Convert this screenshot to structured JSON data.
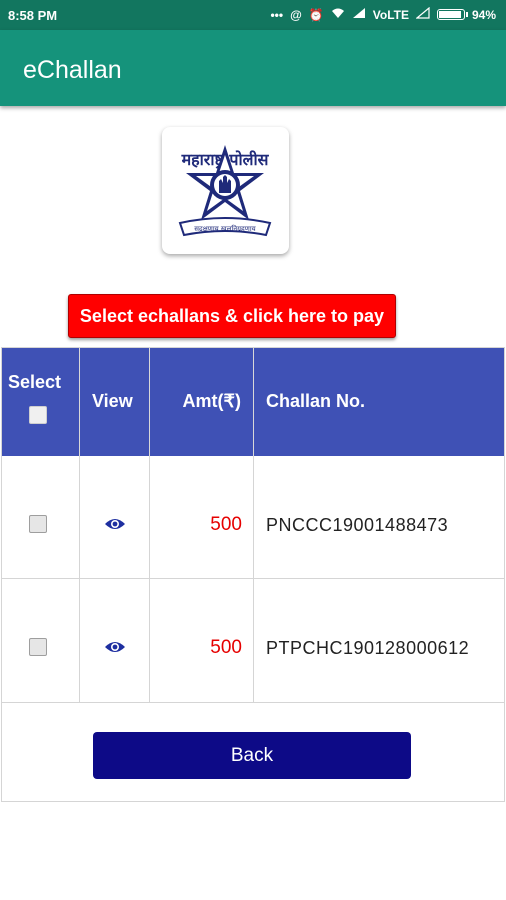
{
  "status_bar": {
    "time": "8:58 PM",
    "network_label": "VoLTE",
    "battery_text": "94%",
    "battery_level": 0.94
  },
  "app_bar": {
    "title": "eChallan"
  },
  "logo": {
    "text_top": "महाराष्ट्र पोलीस",
    "text_bottom": "सद्रक्षणाय खलनिग्रहणाय",
    "colors": {
      "navy": "#1f2a7a"
    }
  },
  "pay_button": {
    "label": "Select echallans & click here to pay",
    "color": "#ff0000"
  },
  "table": {
    "header_color": "#3f51b5",
    "headers": {
      "select": "Select",
      "view": "View",
      "amount": "Amt(₹)",
      "challan_no": "Challan No."
    },
    "rows": [
      {
        "amount": "500",
        "challan_no": "PNCCC19001488473",
        "selected": false
      },
      {
        "amount": "500",
        "challan_no": "PTPCHC190128000612",
        "selected": false
      }
    ]
  },
  "back_button": {
    "label": "Back",
    "color": "#0d0a87"
  }
}
